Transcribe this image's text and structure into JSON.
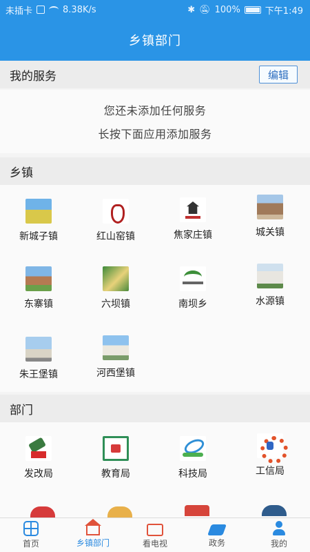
{
  "status_bar": {
    "carrier": "未插卡",
    "speed": "8.38K/s",
    "battery": "100%",
    "time": "下午1:49"
  },
  "header": {
    "title": "乡镇部门"
  },
  "my_services": {
    "title": "我的服务",
    "edit_label": "编辑",
    "empty_line1": "您还未添加任何服务",
    "empty_line2": "长按下面应用添加服务"
  },
  "towns": {
    "title": "乡镇",
    "items": [
      {
        "label": "新城子镇",
        "icon": "field-photo"
      },
      {
        "label": "红山窑镇",
        "icon": "red-vase-logo"
      },
      {
        "label": "焦家庄镇",
        "icon": "tower-logo"
      },
      {
        "label": "城关镇",
        "icon": "gate-tower-photo"
      },
      {
        "label": "东寨镇",
        "icon": "building-photo"
      },
      {
        "label": "六坝镇",
        "icon": "poster-photo"
      },
      {
        "label": "南坝乡",
        "icon": "green-logo"
      },
      {
        "label": "水源镇",
        "icon": "white-building-photo"
      },
      {
        "label": "朱王堡镇",
        "icon": "monument-photo"
      },
      {
        "label": "河西堡镇",
        "icon": "government-building-photo"
      }
    ]
  },
  "departments": {
    "title": "部门",
    "items": [
      {
        "label": "发改局",
        "icon": "reform-stamp-icon"
      },
      {
        "label": "教育局",
        "icon": "education-emblem-icon"
      },
      {
        "label": "科技局",
        "icon": "technology-logo-icon"
      },
      {
        "label": "工信局",
        "icon": "gear-logo-icon"
      }
    ]
  },
  "bottom_nav": [
    {
      "label": "首页",
      "icon": "home-grid-icon"
    },
    {
      "label": "乡镇部门",
      "icon": "house-icon"
    },
    {
      "label": "看电视",
      "icon": "tv-icon"
    },
    {
      "label": "政务",
      "icon": "handshake-icon"
    },
    {
      "label": "我的",
      "icon": "person-icon"
    }
  ],
  "colors": {
    "accent": "#2a94e6",
    "nav_active": "#2a8ae0"
  }
}
